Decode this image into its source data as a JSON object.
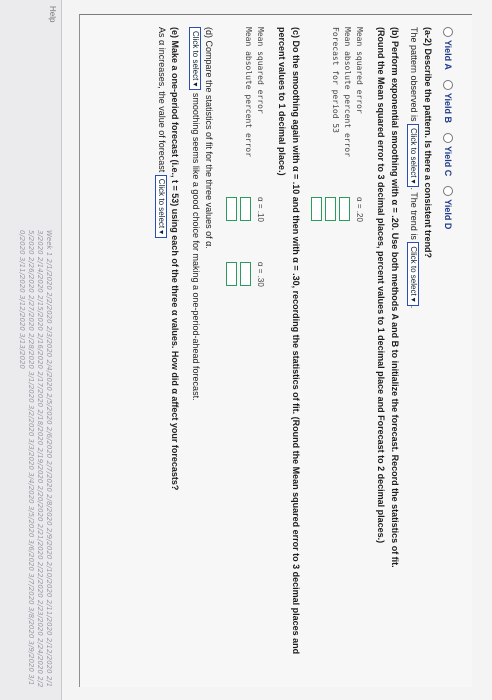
{
  "header": {
    "side_text": "Help",
    "dates_text": "Week 1 2/1/2020 2/2/2020 2/3/2020 2/4/2020 2/5/2020 2/6/2020 2/7/2020 2/8/2020 2/9/2020 2/10/2020 2/11/2020 2/12/2020 2/13/2020 2/14/2020 2/15/2020 2/16/2020 2/17/2020 2/18/2020 2/19/2020 2/20/2020 2/21/2020 2/22/2020 2/23/2020 2/24/2020 2/25/2020 2/26/2020 2/27/2020 2/28/2020 3/1/2020 3/2/2020 3/3/2020 3/4/2020 3/5/2020 3/6/2020 3/7/2020 3/8/2020 3/9/2020 3/10/2020 3/11/2020 3/12/2020 3/13/2020"
  },
  "options": {
    "items": [
      "Yield A",
      "Yield B",
      "Yield C",
      "Yield D"
    ]
  },
  "a2": {
    "question": "(a-2) Describe the pattern. Is there a consistent trend?",
    "pattern_prefix": "The pattern observed is",
    "pattern_select": "Click to select",
    "trend_prefix": "The trend is",
    "trend_select": "Click to select"
  },
  "b": {
    "text_1": "(b) Perform exponential smoothing with α = .20. Use both methods A and B to initialize the forecast. Record the statistics of fit.",
    "text_2": "(Round the Mean squared error to 3 decimal places, percent values to 1 decimal place and Forecast to 2 decimal places.)",
    "labels": [
      "Mean squared error",
      "Mean absolute percent error",
      "Forecast for period 53"
    ],
    "alpha_label": "α = .20"
  },
  "c": {
    "text": "(c) Do the smoothing again with α = .10 and then with α = .30, recording the statistics of fit. (Round the Mean squared error to 3 decimal places and percent values to 1 decimal place.)",
    "labels": [
      "Mean squared error",
      "Mean absolute percent error"
    ],
    "alpha_10": "α = .10",
    "alpha_30": "α = .30"
  },
  "d": {
    "text": "(d) Compare the statistics of fit for the three values of α.",
    "select": "Click to select",
    "sentence": "smoothing seems like a good choice for making a one-period-ahead forecast."
  },
  "e": {
    "text": "(e) Make a one-period forecast (i.e., t = 53) using each of the three α values. How did α affect your forecasts?",
    "prefix": "As α increases, the value of forecast",
    "select": "Click to select"
  }
}
